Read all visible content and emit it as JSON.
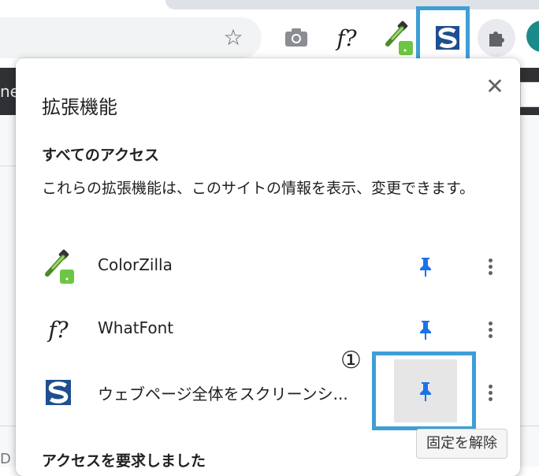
{
  "toolbar": {
    "whatfont_label": "f?",
    "extensions_icon": "puzzle-icon",
    "bookmark_icon": "star-icon",
    "camera_icon": "camera-icon"
  },
  "page": {
    "band_text": "ne",
    "bottom_text": "D"
  },
  "popup": {
    "title": "拡張機能",
    "close_icon": "close-icon",
    "section_title": "すべてのアクセス",
    "section_desc": "これらの拡張機能は、このサイトの情報を表示、変更できます。",
    "extensions": [
      {
        "name": "ColorZilla",
        "icon": "eyedropper-icon"
      },
      {
        "name": "WhatFont",
        "icon_text": "f?"
      },
      {
        "name": "ウェブページ全体をスクリーンシ...",
        "icon": "s-logo-icon"
      }
    ],
    "section2_title": "アクセスを要求しました"
  },
  "annotation": {
    "step_number": "①",
    "tooltip": "固定を解除"
  },
  "colors": {
    "highlight": "#3d9fd6",
    "pin": "#1a73e8",
    "colorzilla_green": "#6cc644"
  }
}
